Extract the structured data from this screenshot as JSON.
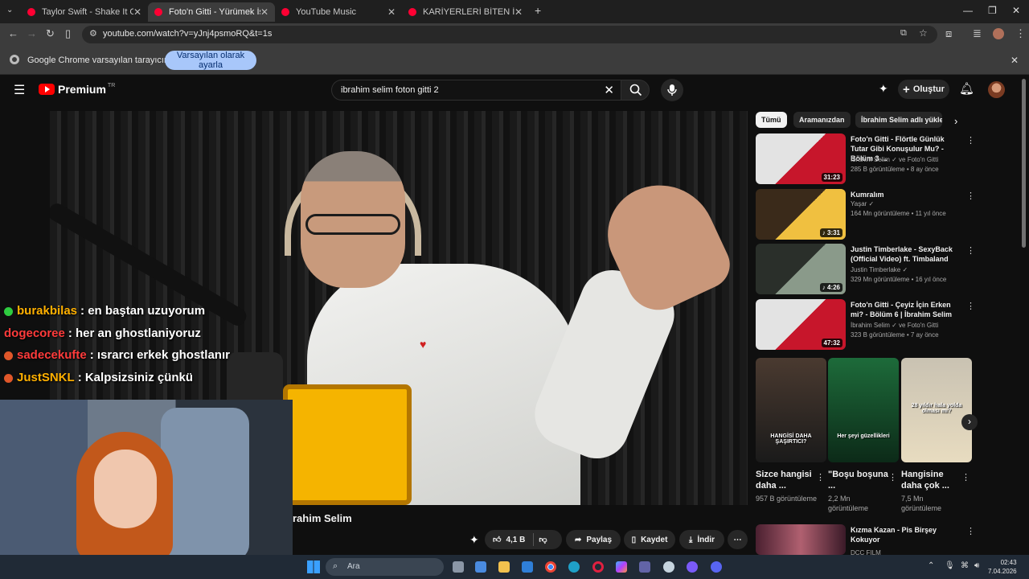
{
  "browser": {
    "tabs": [
      {
        "title": "Taylor Swift - Shake It Off - You",
        "active": false,
        "favicon_color": "#ff0033"
      },
      {
        "title": "Foto'n Gitti - Yürümek İşe Yara",
        "active": true,
        "favicon_color": "#ff0033"
      },
      {
        "title": "YouTube Music",
        "active": false,
        "favicon_color": "#ff0033"
      },
      {
        "title": "KARİYERLERİ BİTEN İĞRENÇ YÖ",
        "active": false,
        "favicon_color": "#ff0033"
      }
    ],
    "url": "youtube.com/watch?v=yJnj4psmoRQ&t=1s",
    "infobar_text": "Google Chrome varsayılan tarayıcınız değil",
    "infobar_button": "Varsayılan olarak ayarla"
  },
  "youtube": {
    "logo_text": "Premium",
    "logo_region": "TR",
    "search_query": "ibrahim selim foton gitti 2",
    "create_label": "Oluştur"
  },
  "chat": [
    {
      "user": "burakbilas",
      "message": ": en baştan uzuyorum",
      "color": "#ffb000",
      "badge": "#2ecc40"
    },
    {
      "user": "dogecoree",
      "message": ": her an ghostlaniyoruz",
      "color": "#ff3b3b",
      "badge": ""
    },
    {
      "user": "sadecekufte",
      "message": ": ısrarcı erkek ghostlanır",
      "color": "#ff3b3b",
      "badge": "#e0572a"
    },
    {
      "user": "JustSNKL",
      "message": ": Kalpsizsiniz çünkü",
      "color": "#ffb000",
      "badge": "#e0572a"
    }
  ],
  "video": {
    "channel_fragment": "rahim Selim",
    "likes": "4,1 B",
    "share_label": "Paylaş",
    "save_label": "Kaydet",
    "download_label": "İndir"
  },
  "sidebar": {
    "chips": [
      "Tümü",
      "Aramanızdan",
      "İbrahim Selim adlı yükleyi"
    ],
    "recommendations": [
      {
        "title": "Foto'n Gitti - Flörtle Günlük Tutar Gibi Konuşulur Mu? - Bölüm 3 ...",
        "channel": "İbrahim Selim ✓ ve Foto'n Gitti",
        "meta": "285 B görüntüleme • 8 ay önce",
        "duration": "31:23",
        "thumb_colors": [
          "#e3e3e3",
          "#c7162b"
        ]
      },
      {
        "title": "Kumralım",
        "channel": "Yaşar ✓",
        "meta": "164 Mn görüntüleme • 11 yıl önce",
        "duration": "♪ 3:31",
        "thumb_colors": [
          "#3a2a1a",
          "#f0c040"
        ]
      },
      {
        "title": "Justin Timberlake - SexyBack (Official Video) ft. Timbaland",
        "channel": "Justin Timberlake ✓",
        "meta": "329 Mn görüntüleme • 16 yıl önce",
        "duration": "♪ 4:26",
        "thumb_colors": [
          "#2a2f2a",
          "#8a9a8a"
        ]
      },
      {
        "title": "Foto'n Gitti - Çeyiz İçin Erken mi? - Bölüm 6 | İbrahim Selim",
        "channel": "İbrahim Selim ✓ ve Foto'n Gitti",
        "meta": "323 B görüntüleme • 7 ay önce",
        "duration": "47:32",
        "thumb_colors": [
          "#e3e3e3",
          "#c7162b"
        ]
      }
    ],
    "shorts": [
      {
        "title": "Sizce hangisi daha ...",
        "views": "957 B görüntüleme",
        "thumb_text": "HANGİSİ DAHA ŞAŞIRTICI?",
        "thumb_colors": [
          "#4a3a30",
          "#1a1a1a"
        ]
      },
      {
        "title": "\"Boşu boşuna ...",
        "views": "2,2 Mn görüntüleme",
        "thumb_text": "Her şeyi güzellikleri",
        "thumb_colors": [
          "#1d6b3a",
          "#0c2a18"
        ]
      },
      {
        "title": "Hangisine daha çok ...",
        "views": "7,5 Mn görüntüleme",
        "thumb_text": "28 yıldır hala yolda olması mı?",
        "thumb_colors": [
          "#c9c2b2",
          "#e8dcc0"
        ]
      }
    ],
    "bottom_rec": {
      "title": "Kızma Kazan - Pis Birşey Kokuyor",
      "channel": "DCC FILM"
    }
  },
  "taskbar": {
    "search_placeholder": "Ara",
    "time": "02:43",
    "date": "7.04.2026"
  }
}
